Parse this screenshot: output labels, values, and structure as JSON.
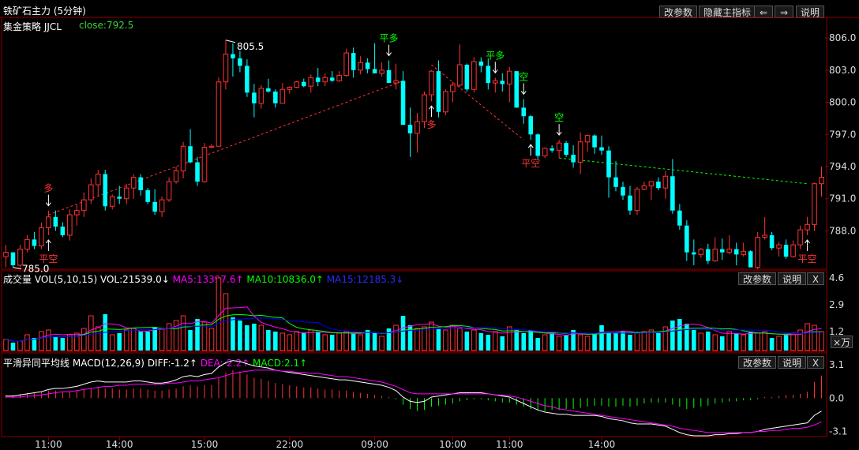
{
  "window": {
    "title": "铁矿石主力 (5分钟)"
  },
  "toolbar": {
    "change_params": "改参数",
    "hide_main": "隐藏主指标",
    "prev": "⇐",
    "next": "⇒",
    "help": "说明"
  },
  "main_panel": {
    "strategy_label": "集金策略 JJCL",
    "close_label": "close:792.5"
  },
  "volume_panel": {
    "title": "成交量",
    "indicator": "VOL(5,10,15)",
    "vol": "VOL:21539.0↓",
    "ma5": "MA5:13397.6↑",
    "ma10": "MA10:10836.0↑",
    "ma15": "MA15:12185.3↓",
    "change_params": "改参数",
    "help": "说明",
    "close": "X",
    "unit": "×万"
  },
  "macd_panel": {
    "title": "平滑异同平均线",
    "indicator": "MACD(12,26,9)",
    "diff": "DIFF:-1.2↑",
    "dea": "DEA:-2.2↑",
    "macd": "MACD:2.1↑",
    "change_params": "改参数",
    "help": "说明",
    "close": "X"
  },
  "colors": {
    "up": "#ff3232",
    "down": "#00ffff",
    "flat": "#ffffff",
    "ma5": "#ff00ff",
    "ma10": "#00ff00",
    "ma15": "#0000ff",
    "signal_long": "#ff3232",
    "signal_close": "#00ff00"
  },
  "chart_data": {
    "type": "candlestick",
    "y_axis_ticks": [
      "806.0",
      "803.0",
      "800.0",
      "797.0",
      "794.0",
      "791.0",
      "788.0"
    ],
    "ylim": [
      784.5,
      806.3
    ],
    "x_axis_ticks": [
      "11:00",
      "14:00",
      "15:00",
      "22:00",
      "09:00",
      "10:00",
      "11:00",
      "14:00"
    ],
    "price_labels": {
      "high": "805.5",
      "low": "785.0"
    },
    "ohlc": [
      [
        785.6,
        786.7,
        784.6,
        786.0
      ],
      [
        786.0,
        786.0,
        784.6,
        784.8
      ],
      [
        784.8,
        786.7,
        784.6,
        786.3
      ],
      [
        786.3,
        787.6,
        786.0,
        787.2
      ],
      [
        787.2,
        787.9,
        786.3,
        786.6
      ],
      [
        786.6,
        788.8,
        786.3,
        788.3
      ],
      [
        788.3,
        789.9,
        787.6,
        789.3
      ],
      [
        789.3,
        789.9,
        788.0,
        788.4
      ],
      [
        788.4,
        788.8,
        787.4,
        787.6
      ],
      [
        787.6,
        790.0,
        787.1,
        789.5
      ],
      [
        789.5,
        790.4,
        788.5,
        789.9
      ],
      [
        789.9,
        791.6,
        789.3,
        790.9
      ],
      [
        790.9,
        792.9,
        790.5,
        792.3
      ],
      [
        792.3,
        793.7,
        791.3,
        793.3
      ],
      [
        793.3,
        793.7,
        789.9,
        790.3
      ],
      [
        790.3,
        791.4,
        790.0,
        791.2
      ],
      [
        791.2,
        792.2,
        790.5,
        791.0
      ],
      [
        791.0,
        792.4,
        790.5,
        792.0
      ],
      [
        792.0,
        793.3,
        791.0,
        793.0
      ],
      [
        793.0,
        793.3,
        791.3,
        791.8
      ],
      [
        791.8,
        792.0,
        790.5,
        790.7
      ],
      [
        790.7,
        791.9,
        789.5,
        789.8
      ],
      [
        789.8,
        791.2,
        789.3,
        790.9
      ],
      [
        790.9,
        793.0,
        790.7,
        792.6
      ],
      [
        792.6,
        794.0,
        792.4,
        793.6
      ],
      [
        793.6,
        796.3,
        792.9,
        795.9
      ],
      [
        795.9,
        797.5,
        794.3,
        794.4
      ],
      [
        794.4,
        794.9,
        792.2,
        792.6
      ],
      [
        792.6,
        796.2,
        792.5,
        795.8
      ],
      [
        795.8,
        796.1,
        795.7,
        795.9
      ],
      [
        795.9,
        802.3,
        795.9,
        801.9
      ],
      [
        801.9,
        805.8,
        801.2,
        804.5
      ],
      [
        804.5,
        805.5,
        802.4,
        804.1
      ],
      [
        804.1,
        804.8,
        802.8,
        803.4
      ],
      [
        803.4,
        804.0,
        800.5,
        800.9
      ],
      [
        800.9,
        801.7,
        798.6,
        799.9
      ],
      [
        799.9,
        801.6,
        799.4,
        801.3
      ],
      [
        801.3,
        802.2,
        800.9,
        801.0
      ],
      [
        801.0,
        801.2,
        799.5,
        799.9
      ],
      [
        799.9,
        801.8,
        799.9,
        801.2
      ],
      [
        801.2,
        801.5,
        800.8,
        801.4
      ],
      [
        801.4,
        802.0,
        801.3,
        801.9
      ],
      [
        801.9,
        802.2,
        801.4,
        801.5
      ],
      [
        801.5,
        802.6,
        800.9,
        802.3
      ],
      [
        802.3,
        803.2,
        801.5,
        801.9
      ],
      [
        801.9,
        802.7,
        801.5,
        802.3
      ],
      [
        802.3,
        802.9,
        801.9,
        802.0
      ],
      [
        802.0,
        802.9,
        801.9,
        802.5
      ],
      [
        802.5,
        805.0,
        802.4,
        804.6
      ],
      [
        804.6,
        805.1,
        802.3,
        803.0
      ],
      [
        803.0,
        804.3,
        802.6,
        803.7
      ],
      [
        803.7,
        804.1,
        802.7,
        803.1
      ],
      [
        803.1,
        805.5,
        802.9,
        802.7
      ],
      [
        802.7,
        803.7,
        802.4,
        803.0
      ],
      [
        803.0,
        803.9,
        802.5,
        801.8
      ],
      [
        801.8,
        803.6,
        801.2,
        802.0
      ],
      [
        802.0,
        802.9,
        797.9,
        797.9
      ],
      [
        797.9,
        799.5,
        794.9,
        797.1
      ],
      [
        797.1,
        799.0,
        795.3,
        798.2
      ],
      [
        798.2,
        801.0,
        797.6,
        800.7
      ],
      [
        800.7,
        803.0,
        800.1,
        802.9
      ],
      [
        802.9,
        803.9,
        798.6,
        799.1
      ],
      [
        799.1,
        801.2,
        798.8,
        801.0
      ],
      [
        801.0,
        801.9,
        800.0,
        801.6
      ],
      [
        801.6,
        805.4,
        801.4,
        803.5
      ],
      [
        803.5,
        803.6,
        801.0,
        801.2
      ],
      [
        801.2,
        804.2,
        800.9,
        803.8
      ],
      [
        803.8,
        804.2,
        802.8,
        803.4
      ],
      [
        803.4,
        804.1,
        801.2,
        801.8
      ],
      [
        801.8,
        802.3,
        800.9,
        802.0
      ],
      [
        802.0,
        802.7,
        801.0,
        801.7
      ],
      [
        801.7,
        803.3,
        800.0,
        802.9
      ],
      [
        802.9,
        802.9,
        799.5,
        799.5
      ],
      [
        799.5,
        800.3,
        798.0,
        798.7
      ],
      [
        798.7,
        798.8,
        796.5,
        797.0
      ],
      [
        797.0,
        797.1,
        794.7,
        795.0
      ],
      [
        795.0,
        795.8,
        794.8,
        795.7
      ],
      [
        795.7,
        796.0,
        795.3,
        795.5
      ],
      [
        795.5,
        796.5,
        794.8,
        796.2
      ],
      [
        796.2,
        796.4,
        794.9,
        795.1
      ],
      [
        795.1,
        796.0,
        793.9,
        794.4
      ],
      [
        794.4,
        797.2,
        793.3,
        796.3
      ],
      [
        796.3,
        797.0,
        795.4,
        796.9
      ],
      [
        796.9,
        797.0,
        795.2,
        795.8
      ],
      [
        795.8,
        796.9,
        795.1,
        795.5
      ],
      [
        795.5,
        795.9,
        791.1,
        793.0
      ],
      [
        793.0,
        794.5,
        791.7,
        792.1
      ],
      [
        792.1,
        792.6,
        790.9,
        791.3
      ],
      [
        791.3,
        792.2,
        789.5,
        789.9
      ],
      [
        789.9,
        792.1,
        789.5,
        791.9
      ],
      [
        791.9,
        792.6,
        791.8,
        792.2
      ],
      [
        792.2,
        792.6,
        790.9,
        792.6
      ],
      [
        792.6,
        793.0,
        791.8,
        792.0
      ],
      [
        792.0,
        793.6,
        791.0,
        793.1
      ],
      [
        793.1,
        794.7,
        789.6,
        789.9
      ],
      [
        789.9,
        790.5,
        788.1,
        788.5
      ],
      [
        788.5,
        789.0,
        785.2,
        786.0
      ],
      [
        786.0,
        787.2,
        784.8,
        785.8
      ],
      [
        785.8,
        786.4,
        785.5,
        786.3
      ],
      [
        786.3,
        786.8,
        784.9,
        785.2
      ],
      [
        785.2,
        787.4,
        785.1,
        786.3
      ],
      [
        786.3,
        787.3,
        785.3,
        786.0
      ],
      [
        786.0,
        787.6,
        785.8,
        786.3
      ],
      [
        786.3,
        786.9,
        784.8,
        785.8
      ],
      [
        785.8,
        786.9,
        785.6,
        786.1
      ],
      [
        786.1,
        786.2,
        784.6,
        784.6
      ],
      [
        784.6,
        787.9,
        784.4,
        787.4
      ],
      [
        787.4,
        789.3,
        787.2,
        787.6
      ],
      [
        787.6,
        787.9,
        786.2,
        786.4
      ],
      [
        786.4,
        787.0,
        785.6,
        786.7
      ],
      [
        786.7,
        787.2,
        785.4,
        785.6
      ],
      [
        785.6,
        787.1,
        785.5,
        786.7
      ],
      [
        786.7,
        788.5,
        786.3,
        788.1
      ],
      [
        788.1,
        789.3,
        787.6,
        788.6
      ],
      [
        788.6,
        792.5,
        788.0,
        792.4
      ],
      [
        792.4,
        794.0,
        791.2,
        793.0
      ]
    ],
    "volume": {
      "ylim": [
        0,
        4.6
      ],
      "y_axis_ticks": [
        "4.6",
        "2.9",
        "1.2"
      ],
      "values": [
        0.7,
        0.5,
        0.6,
        1.0,
        0.8,
        1.2,
        1.3,
        0.9,
        0.8,
        1.0,
        1.1,
        1.4,
        2.2,
        1.5,
        2.3,
        1.0,
        1.1,
        1.3,
        1.4,
        1.2,
        1.2,
        1.5,
        1.4,
        1.7,
        1.9,
        2.2,
        1.3,
        2.0,
        1.8,
        1.4,
        4.6,
        3.6,
        2.1,
        1.9,
        1.6,
        1.7,
        1.6,
        1.3,
        1.2,
        1.1,
        1.0,
        1.2,
        1.1,
        1.3,
        1.2,
        1.0,
        1.0,
        1.1,
        1.2,
        1.1,
        1.0,
        1.3,
        1.1,
        0.9,
        1.4,
        1.6,
        2.2,
        1.6,
        1.4,
        1.5,
        1.8,
        1.4,
        1.3,
        1.6,
        1.4,
        1.2,
        1.3,
        1.1,
        1.0,
        1.2,
        0.9,
        1.5,
        1.3,
        1.1,
        1.3,
        0.8,
        1.0,
        1.1,
        0.9,
        1.0,
        1.3,
        1.0,
        0.9,
        1.1,
        1.6,
        1.2,
        1.1,
        1.2,
        1.0,
        1.1,
        1.2,
        1.3,
        1.1,
        1.5,
        1.9,
        2.0,
        1.7,
        1.3,
        1.1,
        1.2,
        1.0,
        0.9,
        1.2,
        1.1,
        1.0,
        1.2,
        1.1,
        1.2,
        0.8,
        0.9,
        1.0,
        1.1,
        1.3,
        1.7,
        1.6,
        1.2
      ]
    },
    "macd": {
      "ylim": [
        -3.5,
        3.4
      ],
      "y_axis_ticks": [
        "3.1",
        "0.0",
        "-3.1"
      ],
      "hist": [
        0.3,
        0.3,
        0.4,
        0.5,
        0.5,
        0.6,
        0.7,
        0.7,
        0.6,
        0.6,
        0.7,
        0.8,
        0.9,
        1.0,
        0.9,
        0.9,
        0.8,
        0.8,
        0.9,
        0.9,
        0.8,
        0.7,
        0.7,
        0.8,
        0.9,
        1.1,
        1.2,
        1.1,
        1.2,
        1.2,
        1.9,
        2.4,
        2.6,
        2.5,
        2.2,
        1.9,
        1.8,
        1.6,
        1.4,
        1.3,
        1.2,
        1.1,
        1.0,
        1.0,
        0.9,
        0.8,
        0.8,
        0.7,
        0.7,
        0.6,
        0.5,
        0.4,
        0.3,
        0.2,
        0.1,
        -0.1,
        -0.6,
        -1.0,
        -1.2,
        -1.1,
        -0.8,
        -0.7,
        -0.6,
        -0.5,
        -0.3,
        -0.2,
        -0.1,
        -0.1,
        -0.2,
        -0.3,
        -0.4,
        -0.4,
        -0.6,
        -0.8,
        -1.0,
        -1.1,
        -1.2,
        -1.1,
        -1.1,
        -1.0,
        -1.0,
        -0.9,
        -0.8,
        -0.7,
        -0.7,
        -0.8,
        -0.8,
        -0.7,
        -0.8,
        -0.7,
        -0.5,
        -0.4,
        -0.4,
        -0.4,
        -0.6,
        -0.8,
        -1.0,
        -0.9,
        -0.8,
        -0.7,
        -0.5,
        -0.4,
        -0.3,
        -0.3,
        -0.2,
        -0.2,
        -0.1,
        0.1,
        0.1,
        0.2,
        0.3,
        0.3,
        0.4,
        0.6,
        1.5,
        2.1
      ],
      "diff": [
        0.2,
        0.2,
        0.3,
        0.4,
        0.5,
        0.6,
        0.8,
        0.9,
        0.9,
        1.0,
        1.1,
        1.3,
        1.5,
        1.6,
        1.5,
        1.5,
        1.5,
        1.5,
        1.6,
        1.6,
        1.5,
        1.4,
        1.4,
        1.5,
        1.7,
        2.0,
        2.1,
        2.0,
        2.2,
        2.3,
        2.9,
        3.3,
        3.5,
        3.4,
        3.2,
        3.0,
        2.9,
        2.8,
        2.6,
        2.5,
        2.4,
        2.3,
        2.2,
        2.1,
        2.0,
        1.9,
        1.8,
        1.7,
        1.7,
        1.6,
        1.5,
        1.4,
        1.3,
        1.2,
        1.0,
        0.7,
        0.1,
        -0.3,
        -0.4,
        -0.3,
        0.1,
        0.2,
        0.3,
        0.4,
        0.5,
        0.5,
        0.5,
        0.5,
        0.4,
        0.3,
        0.2,
        0.1,
        -0.2,
        -0.5,
        -0.8,
        -1.1,
        -1.3,
        -1.4,
        -1.5,
        -1.5,
        -1.6,
        -1.6,
        -1.6,
        -1.6,
        -1.7,
        -1.9,
        -2.0,
        -2.1,
        -2.3,
        -2.4,
        -2.4,
        -2.4,
        -2.5,
        -2.6,
        -2.9,
        -3.2,
        -3.4,
        -3.5,
        -3.5,
        -3.5,
        -3.4,
        -3.4,
        -3.3,
        -3.3,
        -3.2,
        -3.2,
        -3.1,
        -2.9,
        -2.8,
        -2.7,
        -2.6,
        -2.5,
        -2.4,
        -2.3,
        -1.6,
        -1.2
      ],
      "dea": [
        0.1,
        0.1,
        0.1,
        0.2,
        0.2,
        0.3,
        0.4,
        0.5,
        0.6,
        0.6,
        0.7,
        0.8,
        0.9,
        1.0,
        1.1,
        1.1,
        1.2,
        1.2,
        1.3,
        1.3,
        1.3,
        1.3,
        1.3,
        1.4,
        1.4,
        1.5,
        1.6,
        1.6,
        1.7,
        1.8,
        1.9,
        2.1,
        2.3,
        2.4,
        2.5,
        2.6,
        2.6,
        2.6,
        2.6,
        2.5,
        2.5,
        2.4,
        2.4,
        2.3,
        2.3,
        2.2,
        2.1,
        2.0,
        2.0,
        1.9,
        1.8,
        1.7,
        1.6,
        1.5,
        1.3,
        1.1,
        0.8,
        0.5,
        0.4,
        0.4,
        0.4,
        0.4,
        0.4,
        0.4,
        0.4,
        0.4,
        0.4,
        0.4,
        0.4,
        0.3,
        0.3,
        0.2,
        0.1,
        -0.1,
        -0.3,
        -0.5,
        -0.7,
        -0.8,
        -1.0,
        -1.1,
        -1.2,
        -1.3,
        -1.4,
        -1.5,
        -1.6,
        -1.7,
        -1.8,
        -1.9,
        -2.0,
        -2.1,
        -2.2,
        -2.3,
        -2.4,
        -2.5,
        -2.6,
        -2.8,
        -2.9,
        -3.0,
        -3.1,
        -3.2,
        -3.2,
        -3.2,
        -3.2,
        -3.2,
        -3.2,
        -3.2,
        -3.1,
        -3.1,
        -3.0,
        -3.0,
        -2.9,
        -2.8,
        -2.8,
        -2.7,
        -2.5,
        -2.2
      ]
    },
    "signals": [
      {
        "label": "多",
        "color": "#ff3232",
        "index": 6,
        "pos": "above"
      },
      {
        "label": "平空",
        "color": "#ff3232",
        "index": 6,
        "pos": "below"
      },
      {
        "label": "平多",
        "color": "#00ff00",
        "index": 54,
        "pos": "above"
      },
      {
        "label": "多",
        "color": "#ff3232",
        "index": 60,
        "pos": "below"
      },
      {
        "label": "平多",
        "color": "#00ff00",
        "index": 69,
        "pos": "above"
      },
      {
        "label": "空",
        "color": "#00ff00",
        "index": 73,
        "pos": "above"
      },
      {
        "label": "平空",
        "color": "#ff3232",
        "index": 74,
        "pos": "below"
      },
      {
        "label": "空",
        "color": "#00ff00",
        "index": 78,
        "pos": "above"
      },
      {
        "label": "平空",
        "color": "#ff3232",
        "index": 113,
        "pos": "below"
      }
    ],
    "trend_lines": [
      {
        "from": [
          6,
          789.5
        ],
        "to": [
          56,
          802.0
        ],
        "color": "#ff3232"
      },
      {
        "from": [
          60,
          803.5
        ],
        "to": [
          73,
          796.5
        ],
        "color": "#ff3232"
      },
      {
        "from": [
          78,
          794.8
        ],
        "to": [
          113,
          792.4
        ],
        "color": "#00ff00"
      }
    ]
  }
}
